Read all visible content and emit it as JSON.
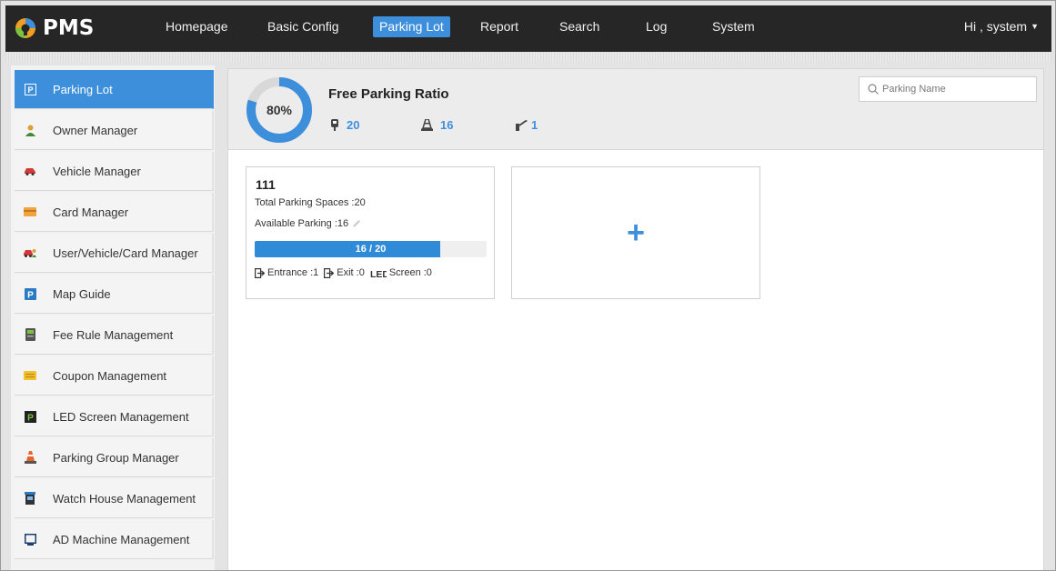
{
  "app": {
    "name": "PMS",
    "nav": [
      {
        "label": "Homepage"
      },
      {
        "label": "Basic Config"
      },
      {
        "label": "Parking Lot"
      },
      {
        "label": "Report"
      },
      {
        "label": "Search"
      },
      {
        "label": "Log"
      },
      {
        "label": "System"
      }
    ],
    "active_nav": "Parking Lot",
    "user_greeting": "Hi , system"
  },
  "sidebar": {
    "items": [
      {
        "label": "Parking Lot",
        "icon": "parking-p-icon"
      },
      {
        "label": "Owner Manager",
        "icon": "person-icon"
      },
      {
        "label": "Vehicle Manager",
        "icon": "car-icon"
      },
      {
        "label": "Card Manager",
        "icon": "card-icon"
      },
      {
        "label": "User/Vehicle/Card Manager",
        "icon": "car-person-icon"
      },
      {
        "label": "Map Guide",
        "icon": "map-parking-icon"
      },
      {
        "label": "Fee Rule Management",
        "icon": "fee-machine-icon"
      },
      {
        "label": "Coupon Management",
        "icon": "coupon-icon"
      },
      {
        "label": "LED Screen Management",
        "icon": "led-screen-icon"
      },
      {
        "label": "Parking Group Manager",
        "icon": "traffic-cone-icon"
      },
      {
        "label": "Watch House Management",
        "icon": "watch-house-icon"
      },
      {
        "label": "AD Machine Management",
        "icon": "monitor-icon"
      }
    ],
    "active": "Parking Lot"
  },
  "summary": {
    "title": "Free Parking Ratio",
    "ratio_label": "80%",
    "ratio": 0.8,
    "total": "20",
    "available": "16",
    "entrances": "1",
    "search_placeholder": "Parking Name"
  },
  "lot_card": {
    "name": "111",
    "total_line": "Total Parking Spaces :20",
    "available_line": "Available Parking :16",
    "occupancy_text": "16 / 20",
    "fill_ratio": 0.8,
    "entrance": "Entrance :1",
    "exit": "Exit :0",
    "screen": "Screen :0"
  },
  "add_card": {
    "symbol": "+"
  },
  "colors": {
    "accent": "#3d8fdb",
    "topbar": "#262626",
    "donut_track": "#d8d8d8"
  }
}
